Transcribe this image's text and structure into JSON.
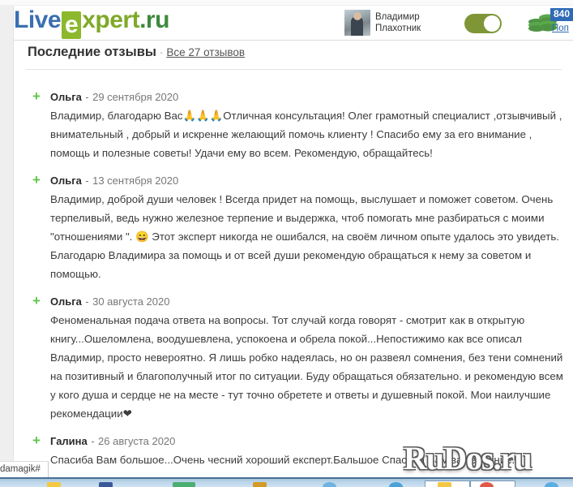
{
  "site": {
    "logo": {
      "part1": "Live",
      "part2": "e",
      "part3": "xpert",
      "part4": ".ru"
    },
    "brand_blue": "#3a6fb0",
    "brand_green": "#8cb82b"
  },
  "header": {
    "user_name_line1": "Владимир",
    "user_name_line2": "Плахотник",
    "avatar_name": "avatar",
    "toggle_state": "on",
    "balance_badge": "840",
    "topup_label": "Поп",
    "coins_icon": "coin-stack-icon"
  },
  "section": {
    "title": "Последние отзывы",
    "separator": "·",
    "all_reviews_link": "Все 27 отзывов"
  },
  "reviews": [
    {
      "icon": "plus-icon",
      "author": "Ольга",
      "dash": "-",
      "date": "29 сентября 2020",
      "text": "Владимир, благодарю Вас🙏🙏🙏Отличная консультация! Олег грамотный специалист ,отзывчивый , внимательный , добрый и искренне желающий помочь клиенту ! Спасибо ему за его внимание , помощь и полезные советы! Удачи ему во всем. Рекомендую, обращайтесь!"
    },
    {
      "icon": "plus-icon",
      "author": "Ольга",
      "dash": "-",
      "date": "13 сентября 2020",
      "text": "Владимир, доброй души человек ! Всегда придет на помощь, выслушает и поможет советом. Очень терпеливый, ведь нужно железное терпение и выдержка, чтоб помогать мне разбираться с моими \"отношениями \". 😄 Этот эксперт никогда не ошибался, на своём личном опыте удалось это увидеть. Благодарю Владимира за помощь и от всей души рекомендую обращаться к нему за советом и помощью."
    },
    {
      "icon": "plus-icon",
      "author": "Ольга",
      "dash": "-",
      "date": "30 августа 2020",
      "text": "Феноменальная подача ответа на вопросы. Тот случай когда говорят - смотрит как в открытую книгу...Ошеломлена, воодушевлена, успокоена и обрела покой...Непостижимо как все описал Владимир, просто невероятно. Я лишь робко надеялась, но он развеял сомнения, без тени сомнений на позитивный и благополучный итог по ситуации. Буду обращаться обязательно. и рекомендую всем у кого душа и сердце не на месте - тут точно обретете и ответы и душевный покой. Мои наилучшие рекомендации❤"
    },
    {
      "icon": "plus-icon",
      "author": "Галина",
      "dash": "-",
      "date": "26 августа 2020",
      "text": "Спасиба Вам большое...Очень чесний хороший експерт.Бальшое Спасиба Вам за терпение..."
    }
  ],
  "overlay": {
    "watermark": "RuDos.ru",
    "bottom_fragment": "damagik#"
  }
}
